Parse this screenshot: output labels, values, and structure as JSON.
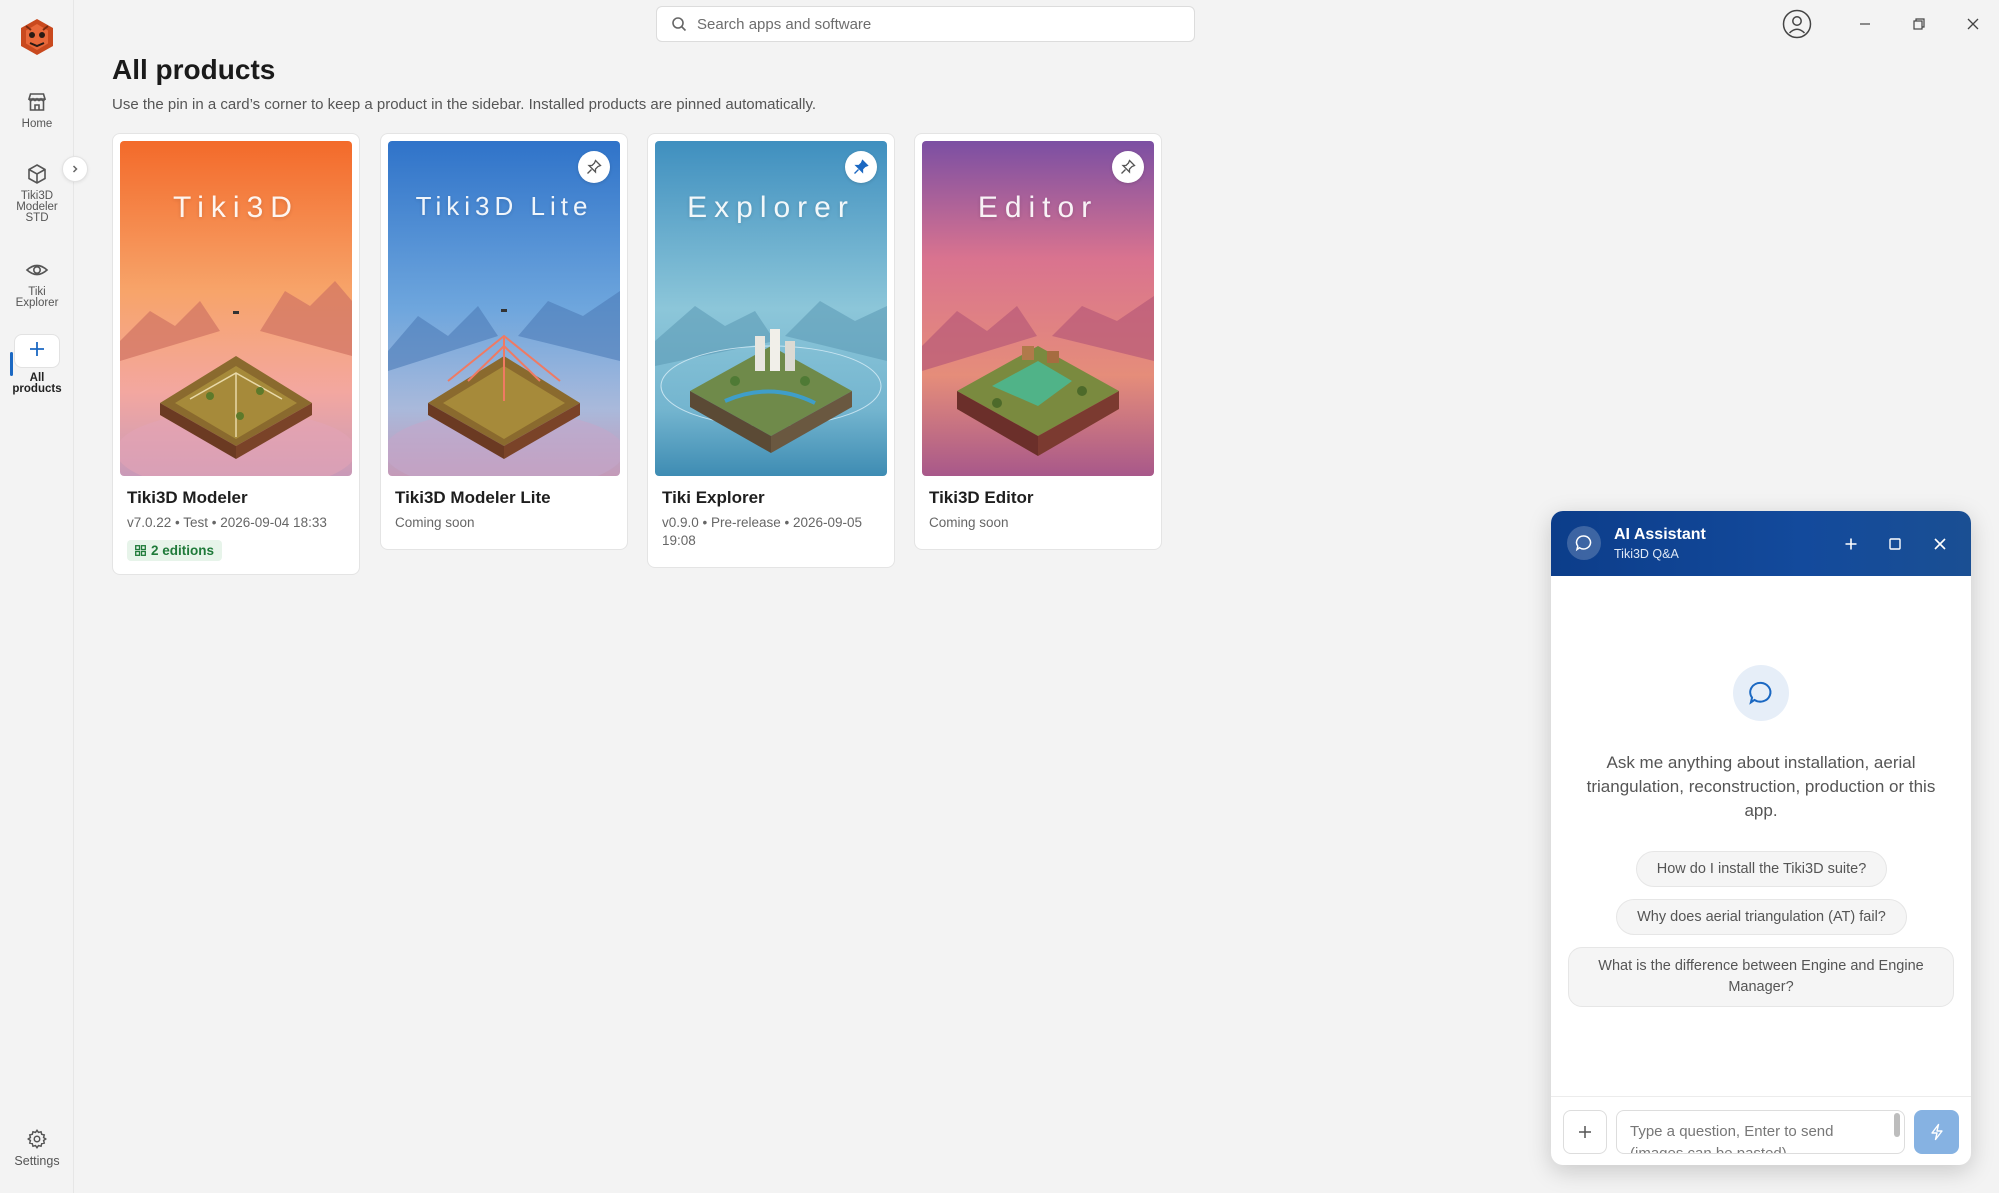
{
  "search": {
    "placeholder": "Search apps and software"
  },
  "sidebar": {
    "items": [
      {
        "label": "Home",
        "icon": "store-icon"
      },
      {
        "label": "Tiki3D Modeler STD",
        "icon": "cube-icon"
      },
      {
        "label": "Tiki Explorer",
        "icon": "eye-icon"
      },
      {
        "label": "All products",
        "icon": "plus-icon",
        "active": true
      }
    ],
    "settings_label": "Settings"
  },
  "header": {
    "title": "All products",
    "subtitle": "Use the pin in a card’s corner to keep a product in the sidebar. Installed products are pinned automatically."
  },
  "products": [
    {
      "art_title": "Tiki3D",
      "name": "Tiki3D Modeler",
      "meta": "v7.0.22  •  Test  •  2026-09-04 18:33",
      "badge": "2 editions",
      "pinned": null
    },
    {
      "art_title": "Tiki3D Lite",
      "name": "Tiki3D Modeler Lite",
      "meta": "Coming soon",
      "pinned": false
    },
    {
      "art_title": "Explorer",
      "name": "Tiki Explorer",
      "meta": "v0.9.0  •  Pre-release  •  2026-09-05 19:08",
      "pinned": true
    },
    {
      "art_title": "Editor",
      "name": "Tiki3D Editor",
      "meta": "Coming soon",
      "pinned": false
    }
  ],
  "assistant": {
    "title": "AI Assistant",
    "subtitle": "Tiki3D Q&A",
    "intro": "Ask me anything about installation, aerial triangulation, reconstruction, production or this app.",
    "suggestions": [
      "How do I install the Tiki3D suite?",
      "Why does aerial triangulation (AT) fail?",
      "What is the difference between Engine and Engine Manager?"
    ],
    "input_placeholder": "Type a question, Enter to send (images can be pasted)"
  },
  "colors": {
    "accent": "#1b68c2",
    "header_bg": "#0c3d8a",
    "badge_green": "#1f7a3a",
    "send_button": "#86b2e2"
  }
}
